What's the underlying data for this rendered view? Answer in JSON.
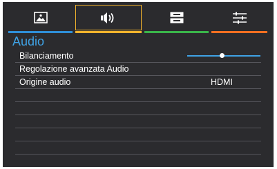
{
  "tabs": [
    {
      "icon": "picture-icon",
      "selected": false,
      "color": "#2f8fd8"
    },
    {
      "icon": "speaker-icon",
      "selected": true,
      "color": "#f2b32d"
    },
    {
      "icon": "display-settings-icon",
      "selected": false,
      "color": "#3ab54a"
    },
    {
      "icon": "sliders-icon",
      "selected": false,
      "color": "#f36f21"
    }
  ],
  "section": {
    "title": "Audio"
  },
  "menu": {
    "items": [
      {
        "label": "Bilanciamento",
        "control": "slider",
        "level": 0.47
      },
      {
        "label": "Regolazione avanzata Audio"
      },
      {
        "label": "Origine audio",
        "value": "HDMI"
      }
    ]
  },
  "colors": {
    "background": "#2b2b2e",
    "accent": "#3fa3e6",
    "selected_border": "#f2b32d",
    "divider": "#56565c"
  }
}
